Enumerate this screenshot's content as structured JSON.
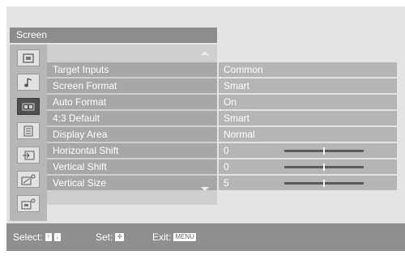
{
  "panel": {
    "title": "Screen"
  },
  "side_icons": [
    {
      "icon": "picture-icon",
      "selected": false
    },
    {
      "icon": "sound-note-icon",
      "selected": false
    },
    {
      "icon": "screen-icon",
      "selected": true
    },
    {
      "icon": "features-list-icon",
      "selected": false
    },
    {
      "icon": "input-icon",
      "selected": false
    },
    {
      "icon": "pc-settings-icon",
      "selected": false
    },
    {
      "icon": "setup-icon",
      "selected": false
    }
  ],
  "menu": {
    "rows": [
      {
        "label": "Target Inputs",
        "value": "Common"
      },
      {
        "label": "Screen Format",
        "value": "Smart"
      },
      {
        "label": "Auto Format",
        "value": "On"
      },
      {
        "label": "4:3 Default",
        "value": "Smart"
      },
      {
        "label": "Display Area",
        "value": "Normal"
      },
      {
        "label": "Horizontal Shift",
        "value": "0",
        "slider_level": 0.5
      },
      {
        "label": "Vertical Shift",
        "value": "0",
        "slider_level": 0.5
      },
      {
        "label": "Vertical Size",
        "value": "5",
        "slider_level": 0.5
      }
    ]
  },
  "footer": {
    "select_label": "Select:",
    "set_label": "Set:",
    "exit_label": "Exit:",
    "exit_key": "MENU",
    "select_keys": [
      "↑",
      "↓"
    ],
    "set_key": "✛"
  }
}
